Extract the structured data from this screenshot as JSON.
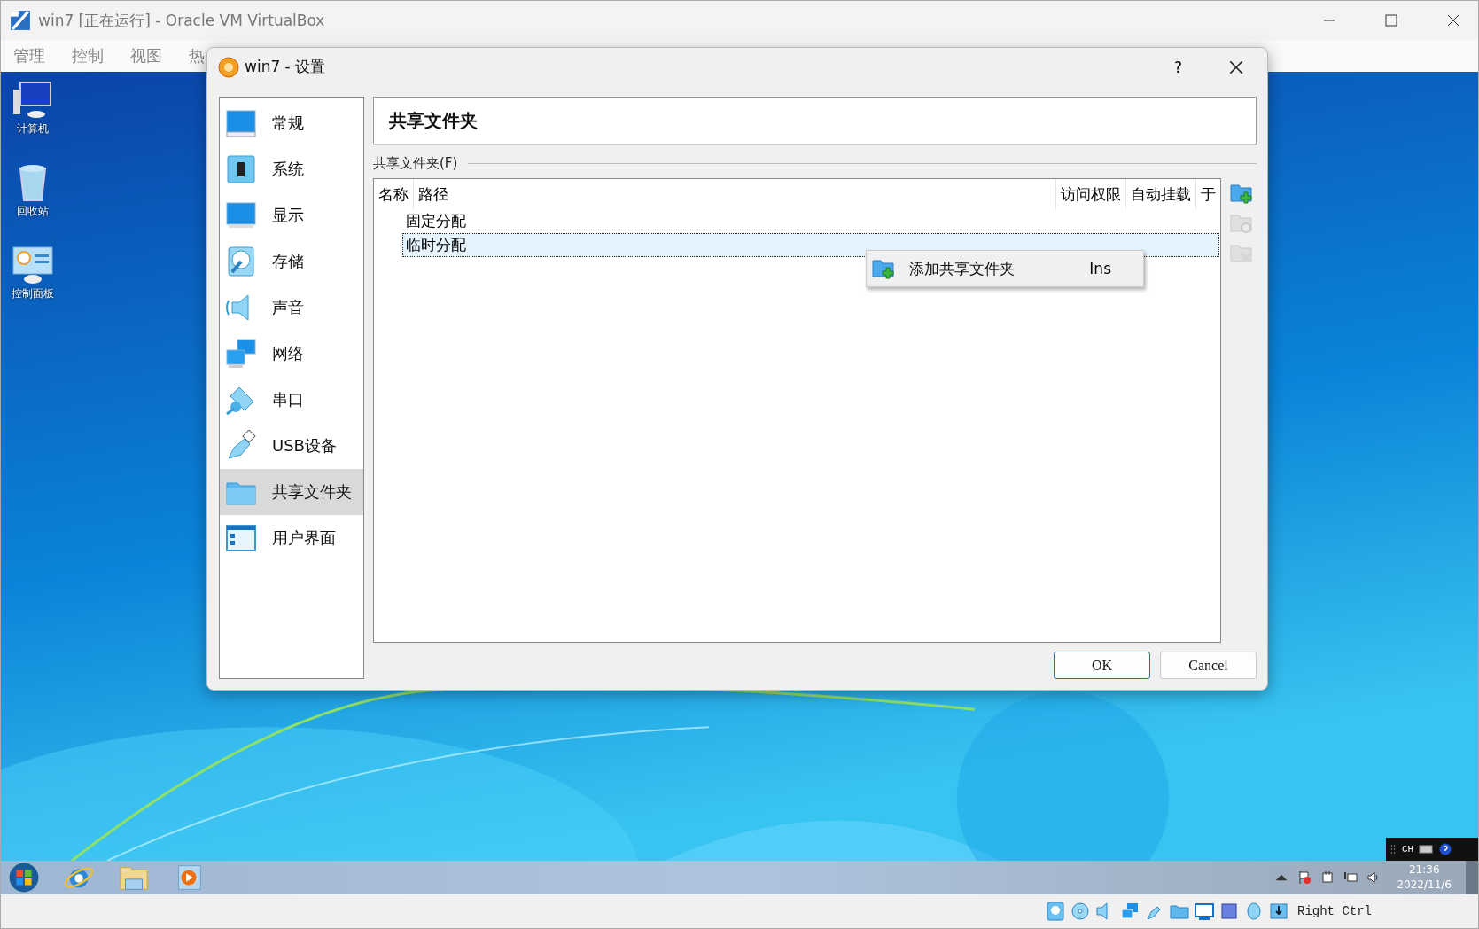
{
  "host_window": {
    "title": "win7 [正在运行] - Oracle VM VirtualBox",
    "menu": [
      "管理",
      "控制",
      "视图",
      "热"
    ]
  },
  "desktop": {
    "icons": [
      {
        "label": "计算机",
        "kind": "computer"
      },
      {
        "label": "回收站",
        "kind": "bin"
      },
      {
        "label": "控制面板",
        "kind": "panel"
      }
    ]
  },
  "dialog": {
    "title": "win7 - 设置",
    "help": "?",
    "sidebar": [
      {
        "label": "常规",
        "kind": "general",
        "selected": false
      },
      {
        "label": "系统",
        "kind": "system",
        "selected": false
      },
      {
        "label": "显示",
        "kind": "display",
        "selected": false
      },
      {
        "label": "存储",
        "kind": "storage",
        "selected": false
      },
      {
        "label": "声音",
        "kind": "audio",
        "selected": false
      },
      {
        "label": "网络",
        "kind": "network",
        "selected": false
      },
      {
        "label": "串口",
        "kind": "serial",
        "selected": false
      },
      {
        "label": "USB设备",
        "kind": "usb",
        "selected": false
      },
      {
        "label": "共享文件夹",
        "kind": "shared",
        "selected": true
      },
      {
        "label": "用户界面",
        "kind": "ui",
        "selected": false
      }
    ],
    "section_title": "共享文件夹",
    "group_label": "共享文件夹(F)",
    "table": {
      "columns": [
        "名称",
        "路径",
        "访问权限",
        "自动挂载",
        "于"
      ],
      "rows": [
        {
          "label": "固定分配",
          "selected": false
        },
        {
          "label": "临时分配",
          "selected": true
        }
      ]
    },
    "side_tools": [
      {
        "kind": "add",
        "disabled": false
      },
      {
        "kind": "edit",
        "disabled": true
      },
      {
        "kind": "remove",
        "disabled": true
      }
    ],
    "context_menu": {
      "items": [
        {
          "label": "添加共享文件夹",
          "shortcut": "Ins"
        }
      ]
    },
    "buttons": [
      {
        "label": "OK",
        "default": true
      },
      {
        "label": "Cancel",
        "default": false
      }
    ]
  },
  "guest_taskbar": {
    "apps": [
      {
        "kind": "start"
      },
      {
        "kind": "browser"
      },
      {
        "kind": "explorer"
      },
      {
        "kind": "media"
      }
    ],
    "clock": {
      "time": "21:36",
      "date": "2022/11/6"
    },
    "ime": "CH"
  },
  "status_bar": {
    "host_key": "Right Ctrl"
  }
}
